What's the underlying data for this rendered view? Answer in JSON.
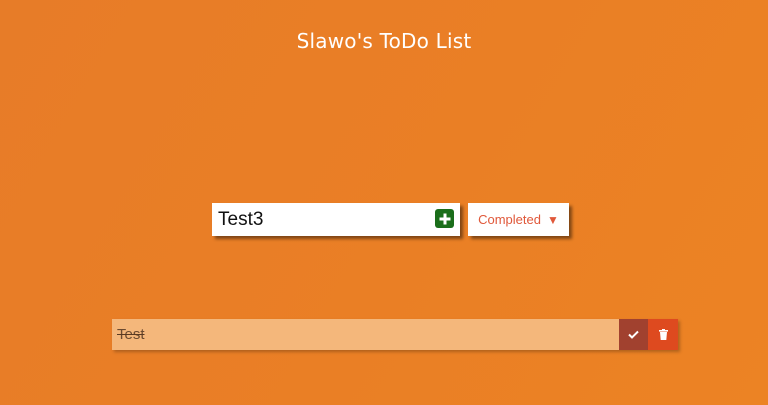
{
  "header": {
    "title": "Slawo's ToDo List"
  },
  "form": {
    "input_value": "Test3",
    "add_icon": "plus-square-icon",
    "filter": {
      "selected": "Completed",
      "chevron_icon": "triangle-down-icon"
    }
  },
  "todos": [
    {
      "text": "Test",
      "completed": true,
      "complete_icon": "check-icon",
      "delete_icon": "trash-icon"
    }
  ],
  "colors": {
    "background": "#ea7f25",
    "accent": "#e0583a",
    "add_button": "#1a6e1a",
    "item_background": "#f4b77b",
    "complete_button": "#a1412f",
    "delete_button": "#de4a1f"
  }
}
